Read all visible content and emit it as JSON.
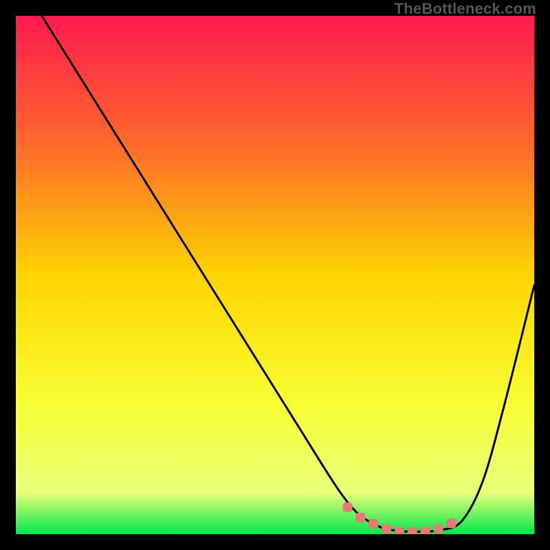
{
  "watermark": "TheBottleneck.com",
  "chart_data": {
    "type": "line",
    "title": "",
    "xlabel": "",
    "ylabel": "",
    "xlim": [
      0,
      100
    ],
    "ylim": [
      0,
      100
    ],
    "gradient_colors": {
      "top": "#ff1a4f",
      "upper_mid": "#ff6a2a",
      "mid": "#ffd400",
      "lower_mid": "#f8ff33",
      "low": "#e9ff7a",
      "bottom": "#00e84a"
    },
    "curve_color": "#000000",
    "marker_color": "#e77a76",
    "series": [
      {
        "name": "bottleneck-curve",
        "x": [
          5,
          10,
          15,
          20,
          25,
          30,
          35,
          40,
          45,
          50,
          55,
          60,
          63,
          66,
          70,
          74,
          78,
          82,
          86,
          90,
          94,
          100
        ],
        "y": [
          100,
          92,
          84,
          76,
          68,
          60,
          52,
          44,
          36,
          28,
          20,
          12,
          7.5,
          4,
          1.5,
          0.6,
          0.5,
          0.8,
          2.5,
          10,
          24,
          48
        ]
      }
    ],
    "markers": {
      "name": "highlight-band",
      "x": [
        64,
        66.5,
        69,
        71.5,
        74,
        76.5,
        79,
        81.5,
        84
      ],
      "y": [
        5.2,
        3.2,
        2.0,
        1.0,
        0.6,
        0.5,
        0.6,
        1.0,
        2.1
      ]
    }
  }
}
